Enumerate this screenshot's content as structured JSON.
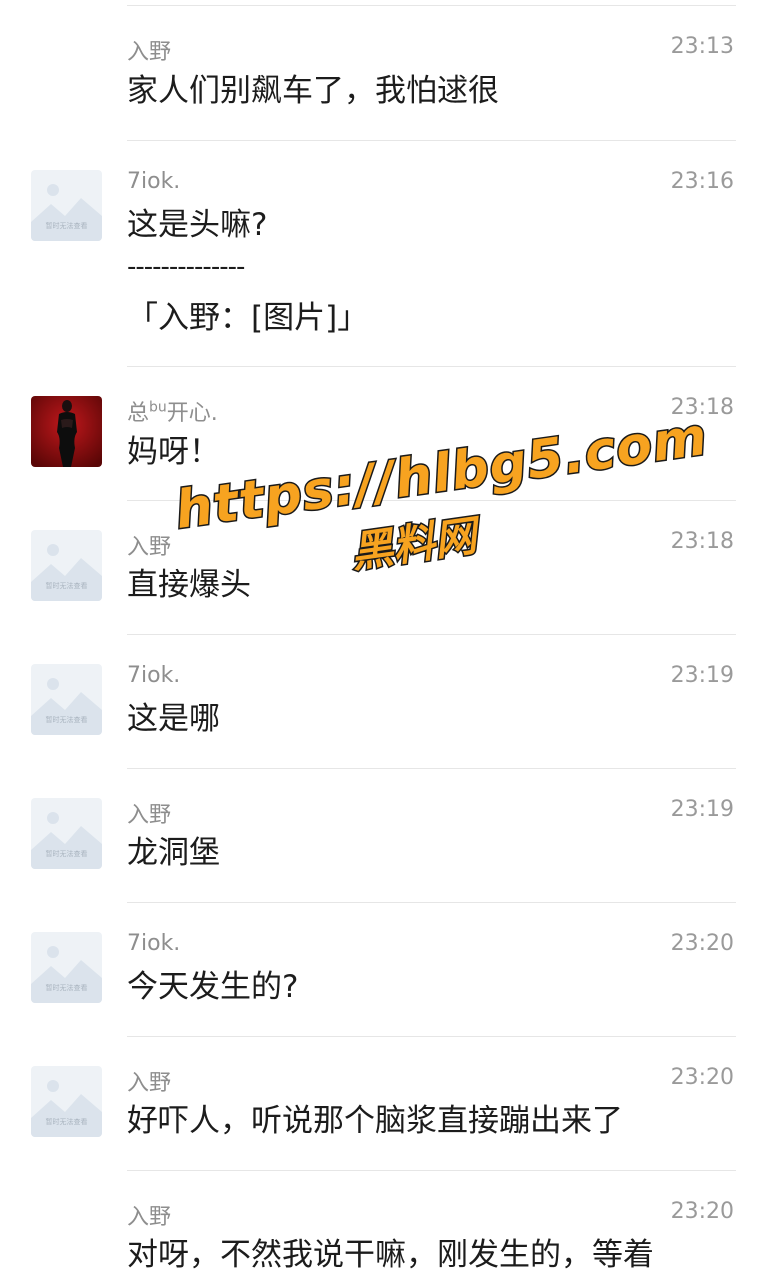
{
  "messages": [
    {
      "sender": "入野",
      "time": "23:13",
      "text": "家人们别飙车了，我怕逑很",
      "avatar": "none"
    },
    {
      "sender": "7iok.",
      "time": "23:16",
      "text": "这是头嘛?",
      "quote_sep": "--------------",
      "quote": "「入野：[图片]」",
      "avatar": "placeholder-image-icon"
    },
    {
      "sender_pre": "总",
      "sender_sup": "bu",
      "sender_post": "开心.",
      "time": "23:18",
      "text": "妈呀！",
      "avatar": "user-photo"
    },
    {
      "sender": "入野",
      "time": "23:18",
      "text": "直接爆头",
      "avatar": "placeholder-image-icon"
    },
    {
      "sender": "7iok.",
      "time": "23:19",
      "text": "这是哪",
      "avatar": "placeholder-image-icon"
    },
    {
      "sender": "入野",
      "time": "23:19",
      "text": "龙洞堡",
      "avatar": "placeholder-image-icon"
    },
    {
      "sender": "7iok.",
      "time": "23:20",
      "text": "今天发生的?",
      "avatar": "placeholder-image-icon"
    },
    {
      "sender": "入野",
      "time": "23:20",
      "text": "好吓人，听说那个脑浆直接蹦出来了",
      "avatar": "placeholder-image-icon"
    },
    {
      "sender": "入野",
      "time": "23:20",
      "text": "对呀，不然我说干嘛，刚发生的，等着",
      "avatar": "none"
    }
  ],
  "placeholder_caption": "暂时无法查看",
  "watermark": {
    "line1": "https://hlbg5.com",
    "line2": "黑料网",
    "color": "#f7a320"
  }
}
